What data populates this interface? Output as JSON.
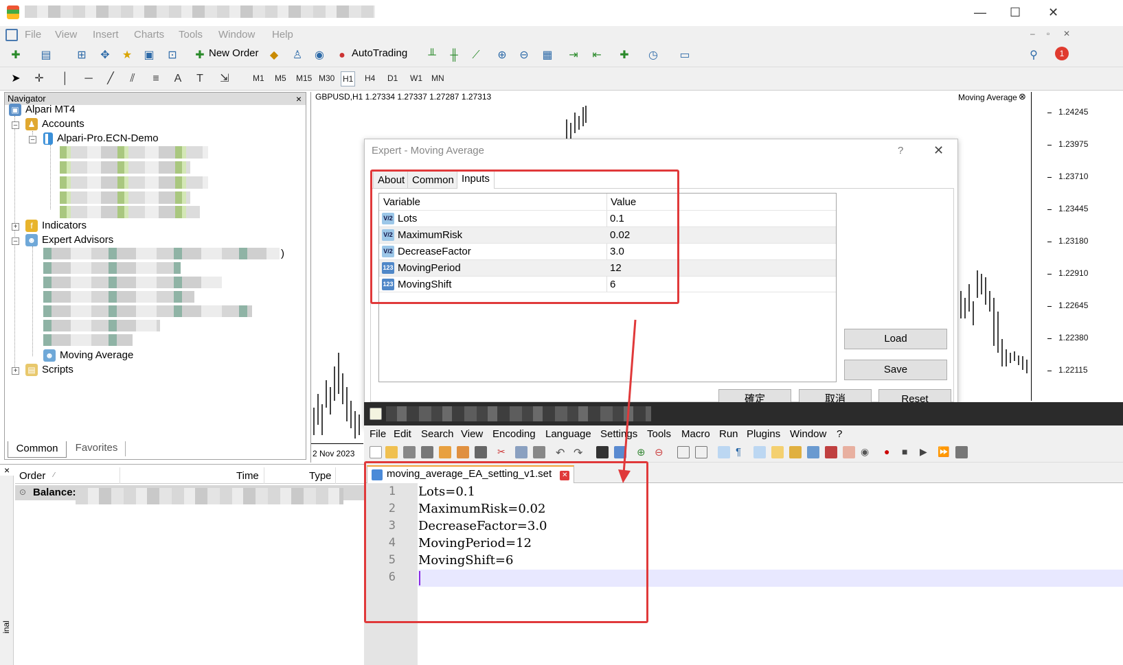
{
  "menu": [
    "File",
    "View",
    "Insert",
    "Charts",
    "Tools",
    "Window",
    "Help"
  ],
  "toolbar": {
    "new_order": "New Order",
    "auto_trading": "AutoTrading",
    "notification_count": "1"
  },
  "timeframes": [
    "M1",
    "M5",
    "M15",
    "M30",
    "H1",
    "H4",
    "D1",
    "W1",
    "MN"
  ],
  "navigator": {
    "title": "Navigator",
    "close": "×",
    "root": "Alpari MT4",
    "accounts": "Accounts",
    "account_name": "Alpari-Pro.ECN-Demo",
    "indicators": "Indicators",
    "expert_advisors": "Expert Advisors",
    "moving_average": "Moving Average",
    "scripts": "Scripts",
    "ea_paren": ")",
    "tabs": [
      "Common",
      "Favorites"
    ]
  },
  "chart": {
    "symbol_info": "GBPUSD,H1  1.27334 1.27337 1.27287 1.27313",
    "indicator_label": "Moving Average",
    "date_label": "2 Nov 2023",
    "prices": [
      "1.24245",
      "1.23975",
      "1.23710",
      "1.23445",
      "1.23180",
      "1.22910",
      "1.22645",
      "1.22380",
      "1.22115"
    ]
  },
  "terminal": {
    "close": "×",
    "columns": [
      "Order",
      "Time",
      "Type"
    ],
    "balance_label": "Balance:",
    "side_label": "inal"
  },
  "dialog": {
    "title": "Expert - Moving Average",
    "help": "?",
    "close": "✕",
    "tabs": [
      "About",
      "Common",
      "Inputs"
    ],
    "columns": [
      "Variable",
      "Value"
    ],
    "inputs": [
      {
        "icon": "V/2",
        "name": "Lots",
        "value": "0.1"
      },
      {
        "icon": "V/2",
        "name": "MaximumRisk",
        "value": "0.02"
      },
      {
        "icon": "V/2",
        "name": "DecreaseFactor",
        "value": "3.0"
      },
      {
        "icon": "123",
        "name": "MovingPeriod",
        "value": "12"
      },
      {
        "icon": "123",
        "name": "MovingShift",
        "value": "6"
      }
    ],
    "load": "Load",
    "save": "Save",
    "ok": "確定",
    "cancel": "取消",
    "reset": "Reset"
  },
  "notepad": {
    "menu": [
      "File",
      "Edit",
      "Search",
      "View",
      "Encoding",
      "Language",
      "Settings",
      "Tools",
      "Macro",
      "Run",
      "Plugins",
      "Window",
      "?"
    ],
    "tab_name": "moving_average_EA_setting_v1.set",
    "tab_close": "✕",
    "lines": [
      "Lots=0.1",
      "MaximumRisk=0.02",
      "DecreaseFactor=3.0",
      "MovingPeriod=12",
      "MovingShift=6",
      ""
    ],
    "line_numbers": [
      "1",
      "2",
      "3",
      "4",
      "5",
      "6"
    ]
  },
  "colors": {
    "highlight": "#e0393a",
    "accent": "#2d6aa8"
  }
}
